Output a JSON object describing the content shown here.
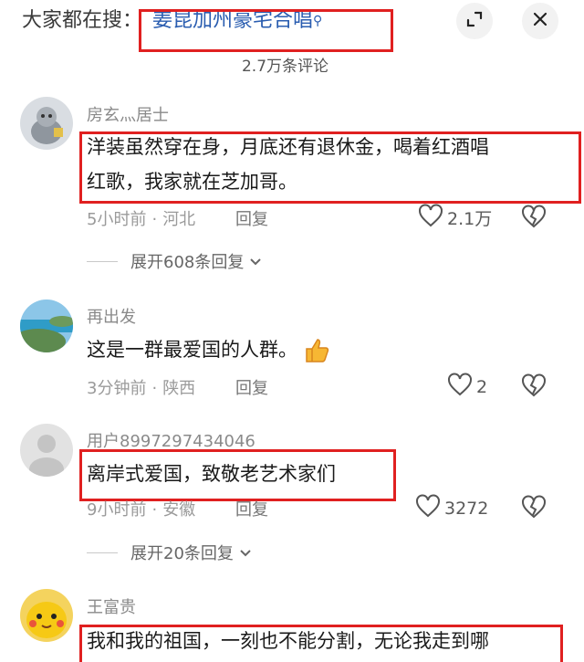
{
  "header": {
    "prefix": "大家都在搜：",
    "search_term": "姜昆加州豪宅合唱",
    "comment_count": "2.7万条评论"
  },
  "comments": [
    {
      "username": "房玄灬居士",
      "text_line1": "洋装虽然穿在身，月底还有退休金，喝着红酒唱",
      "text_line2": "红歌，我家就在芝加哥。",
      "time": "5小时前",
      "location": "河北",
      "reply": "回复",
      "likes": "2.1万",
      "expand": "展开608条回复"
    },
    {
      "username": "再出发",
      "text": "这是一群最爱国的人群。",
      "time": "3分钟前",
      "location": "陕西",
      "reply": "回复",
      "likes": "2"
    },
    {
      "username": "用户8997297434046",
      "text": "离岸式爱国，致敬老艺术家们",
      "time": "9小时前",
      "location": "安徽",
      "reply": "回复",
      "likes": "3272",
      "expand": "展开20条回复"
    },
    {
      "username": "王富贵",
      "text": "我和我的祖国，一刻也不能分割，无论我走到哪"
    }
  ],
  "icons": {
    "expand": "expand-icon",
    "close": "close-icon",
    "like": "heart-outline-icon",
    "dislike": "broken-heart-icon",
    "chevron": "chevron-down-icon",
    "thumbs_up": "thumbs-up-emoji"
  },
  "colors": {
    "highlight_box": "#e02020",
    "search_term": "#2a5db0",
    "muted_text": "#9a9a9a"
  }
}
